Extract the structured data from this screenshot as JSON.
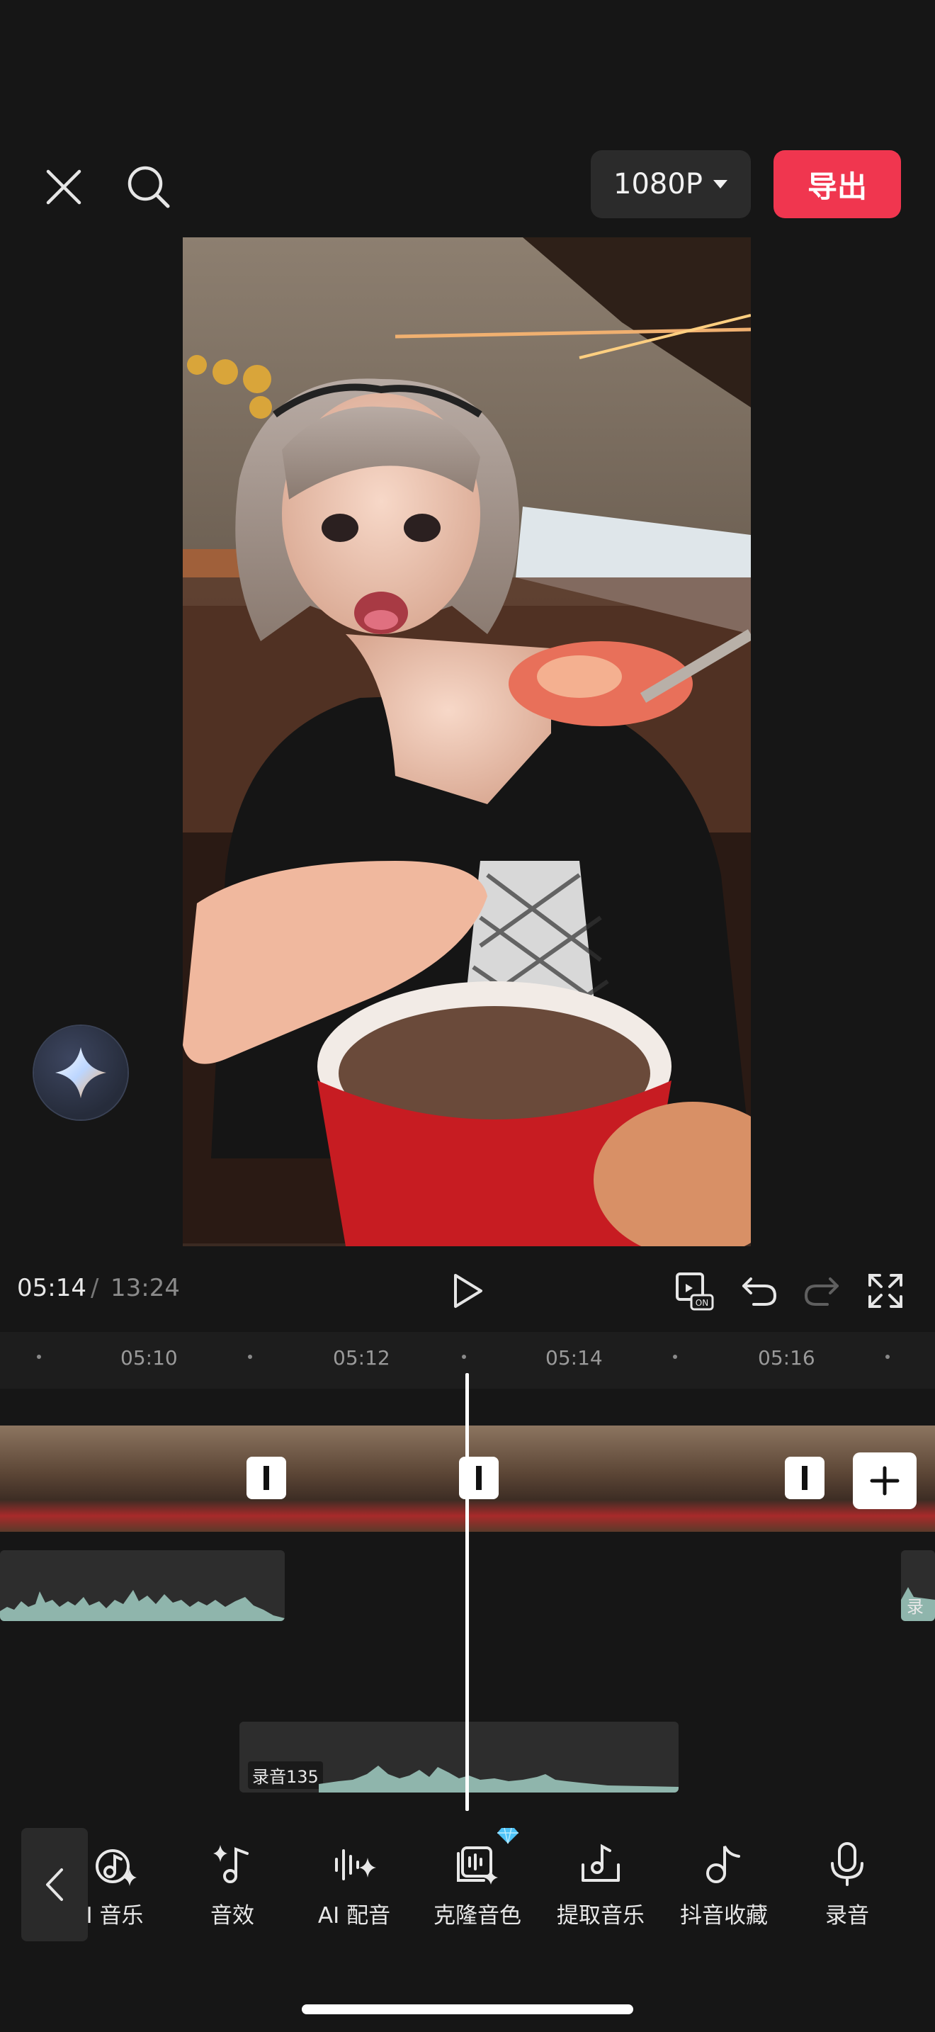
{
  "header": {
    "resolution_label": "1080P",
    "export_label": "导出"
  },
  "icons": {
    "close": "close-icon",
    "search": "search-icon",
    "ai_assistant": "sparkle-icon",
    "play": "play-icon",
    "keyframe": "keyframe-on-icon",
    "undo": "undo-icon",
    "redo": "redo-icon",
    "fullscreen": "fullscreen-icon"
  },
  "transport": {
    "current_time": "05:14",
    "separator": "/",
    "total_time": "13:24",
    "keyframe_badge": "ON"
  },
  "timeline": {
    "ruler_labels": [
      "05:10",
      "05:12",
      "05:14",
      "05:16"
    ],
    "audio_tracks": [
      {
        "label": "录音135"
      },
      {
        "label": "录音"
      }
    ]
  },
  "toolbar": {
    "items": [
      {
        "label": "I 音乐",
        "icon": "music-sparkle-icon"
      },
      {
        "label": "音效",
        "icon": "sound-effect-icon"
      },
      {
        "label": "AI 配音",
        "icon": "ai-voice-icon"
      },
      {
        "label": "克隆音色",
        "icon": "clone-voice-icon",
        "premium": true
      },
      {
        "label": "提取音乐",
        "icon": "extract-music-icon"
      },
      {
        "label": "抖音收藏",
        "icon": "douyin-favorites-icon"
      },
      {
        "label": "录音",
        "icon": "microphone-icon"
      }
    ]
  },
  "colors": {
    "accent": "#f0364f",
    "background": "#161616",
    "waveform": "#8fb5ac",
    "premium": "#4fc3f7"
  }
}
